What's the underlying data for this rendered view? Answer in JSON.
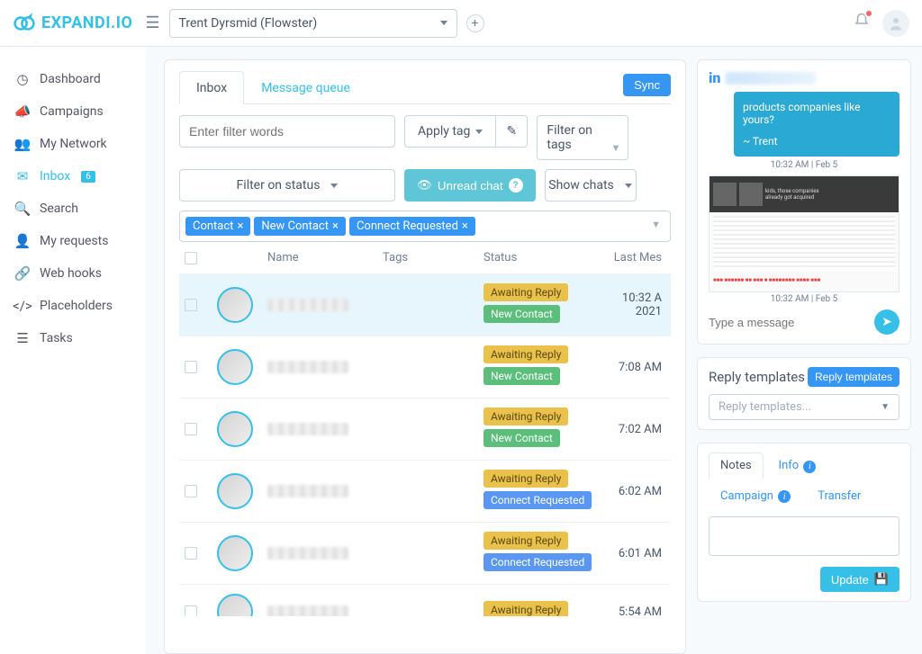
{
  "brand": {
    "name1": "EXPAND",
    "name2": "I.IO"
  },
  "account_selected": "Trent Dyrsmid (Flowster)",
  "sidebar": {
    "items": [
      {
        "label": "Dashboard",
        "icon": "dashboard-icon"
      },
      {
        "label": "Campaigns",
        "icon": "megaphone-icon"
      },
      {
        "label": "My Network",
        "icon": "users-icon"
      },
      {
        "label": "Inbox",
        "icon": "inbox-icon",
        "badge": "6",
        "active": true
      },
      {
        "label": "Search",
        "icon": "search-icon"
      },
      {
        "label": "My requests",
        "icon": "requests-icon"
      },
      {
        "label": "Web hooks",
        "icon": "webhook-icon"
      },
      {
        "label": "Placeholders",
        "icon": "code-icon"
      },
      {
        "label": "Tasks",
        "icon": "tasks-icon"
      }
    ]
  },
  "tabs": {
    "inbox": "Inbox",
    "queue": "Message queue"
  },
  "buttons": {
    "sync": "Sync",
    "apply_tag": "Apply tag",
    "filter_tags": "Filter on tags",
    "filter_status": "Filter on status",
    "unread_chat": "Unread chat",
    "show_chats": "Show chats",
    "reply_templates": "Reply templates",
    "update": "Update"
  },
  "placeholders": {
    "filter_words": "Enter filter words",
    "type_message": "Type a message",
    "reply_select": "Reply templates..."
  },
  "chips": [
    {
      "label": "Contact"
    },
    {
      "label": "New Contact"
    },
    {
      "label": "Connect Requested"
    }
  ],
  "columns": {
    "name": "Name",
    "tags": "Tags",
    "status": "Status",
    "last": "Last Mes"
  },
  "status_labels": {
    "awaiting": "Awaiting Reply",
    "newcontact": "New Contact",
    "connect": "Connect Requested"
  },
  "rows": [
    {
      "time": "10:32 A",
      "time2": "2021",
      "badges": [
        "awaiting",
        "newcontact"
      ],
      "selected": true
    },
    {
      "time": "7:08 AM",
      "badges": [
        "awaiting",
        "newcontact"
      ]
    },
    {
      "time": "7:02 AM",
      "badges": [
        "awaiting",
        "newcontact"
      ]
    },
    {
      "time": "6:02 AM",
      "badges": [
        "awaiting",
        "connect"
      ]
    },
    {
      "time": "6:01 AM",
      "badges": [
        "awaiting",
        "connect"
      ]
    },
    {
      "time": "5:54 AM",
      "badges": [
        "awaiting"
      ]
    }
  ],
  "conversation": {
    "bubble_text": "products companies like yours?",
    "signoff": "~ Trent",
    "time1": "10:32 AM | Feb 5",
    "time2": "10:32 AM | Feb 5"
  },
  "reply_section_title": "Reply templates",
  "notes": {
    "tabs": {
      "notes": "Notes",
      "info": "Info",
      "campaign": "Campaign",
      "transfer": "Transfer"
    }
  }
}
